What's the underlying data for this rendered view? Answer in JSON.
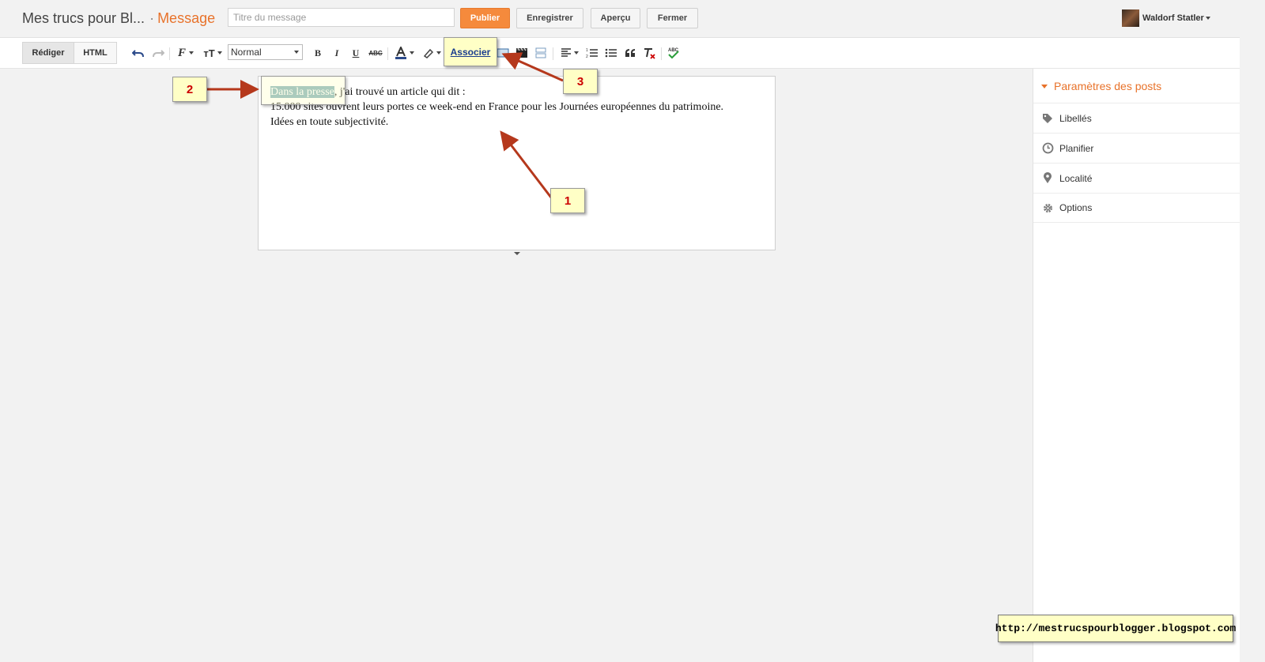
{
  "header": {
    "blog_title": "Mes trucs pour Bl...",
    "separator": "·",
    "section": "Message",
    "title_placeholder": "Titre du message",
    "buttons": {
      "publish": "Publier",
      "save": "Enregistrer",
      "preview": "Aperçu",
      "close": "Fermer"
    },
    "user_name": "Waldorf Statler"
  },
  "toolbar": {
    "mode_compose": "Rédiger",
    "mode_html": "HTML",
    "format_value": "Normal",
    "bold": "B",
    "italic": "I",
    "underline": "U",
    "strike": "ABC",
    "link_popup": "Associer"
  },
  "editor": {
    "line1_selected": "Dans la presse",
    "line1_rest": ", j'ai trouvé un article qui dit :",
    "line2": "15.000 sites ouvrent leurs portes ce week-end en France pour les Journées européennes du patrimoine.",
    "line3": "Idées en toute subjectivité."
  },
  "annotations": {
    "note1": "1",
    "note2": "2",
    "note3": "3",
    "url": "http://mestrucspourblogger.blogspot.com",
    "color": "#b5381c"
  },
  "sidebar": {
    "heading": "Paramètres des posts",
    "items": [
      {
        "label": "Libellés",
        "icon": "tag-icon"
      },
      {
        "label": "Planifier",
        "icon": "clock-icon"
      },
      {
        "label": "Localité",
        "icon": "location-pin-icon"
      },
      {
        "label": "Options",
        "icon": "gear-icon"
      }
    ]
  },
  "colors": {
    "accent": "#e8722a",
    "publish": "#f58a3c",
    "selection": "#7fb0b8",
    "note_bg": "#ffffc6"
  }
}
